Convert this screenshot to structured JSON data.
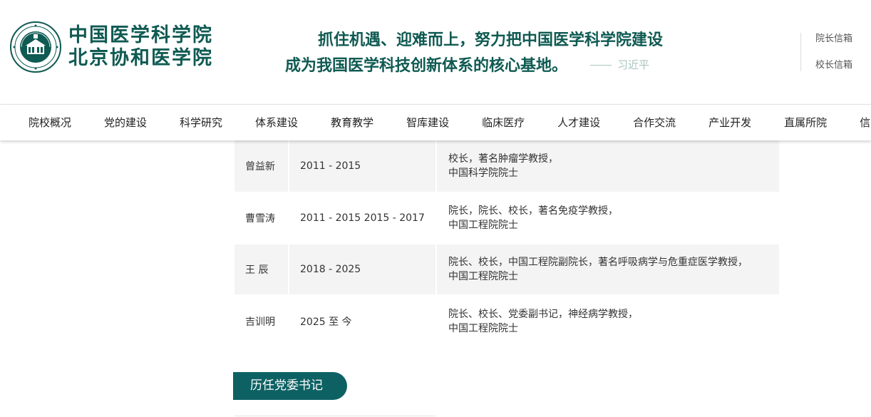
{
  "header": {
    "logo": {
      "line1": "中国医学科学院",
      "line2": "北京协和医学院"
    },
    "slogan": {
      "line1": "抓住机遇、迎难而上，努力把中国医学科学院建设",
      "line2": "成为我国医学科技创新体系的核心基地。",
      "signature": "习近平"
    },
    "links": [
      "院长信箱",
      "校长信箱"
    ]
  },
  "nav": {
    "items": [
      "院校概况",
      "党的建设",
      "科学研究",
      "体系建设",
      "教育教学",
      "智库建设",
      "临床医疗",
      "人才建设",
      "合作交流",
      "产业开发",
      "直属所院",
      "信"
    ]
  },
  "leaders": [
    {
      "name": "曾益新",
      "years": "2011 - 2015",
      "title_line1": "校长，著名肿瘤学教授，",
      "title_line2": "中国科学院院士"
    },
    {
      "name": "曹雪涛",
      "years": "2011 - 2015 2015 - 2017",
      "title_line1": "院长，院长、校长，著名免疫学教授，",
      "title_line2": "中国工程院院士"
    },
    {
      "name": "王 辰",
      "years": "2018 - 2025",
      "title_line1": "院长、校长，中国工程院副院长，著名呼吸病学与危重症医学教授，",
      "title_line2": "中国工程院院士"
    },
    {
      "name": "吉训明",
      "years": "2025 至 今",
      "title_line1": "院长、校长、党委副书记，神经病学教授，",
      "title_line2": "中国工程院院士"
    }
  ],
  "section": {
    "tab_label": "历任党委书记"
  },
  "colors": {
    "brand_green": "#0f5a52",
    "tab_teal": "#0d6163",
    "row_shade": "#f4f4f4"
  },
  "icons": {
    "emblem": "institution-emblem-seal"
  }
}
